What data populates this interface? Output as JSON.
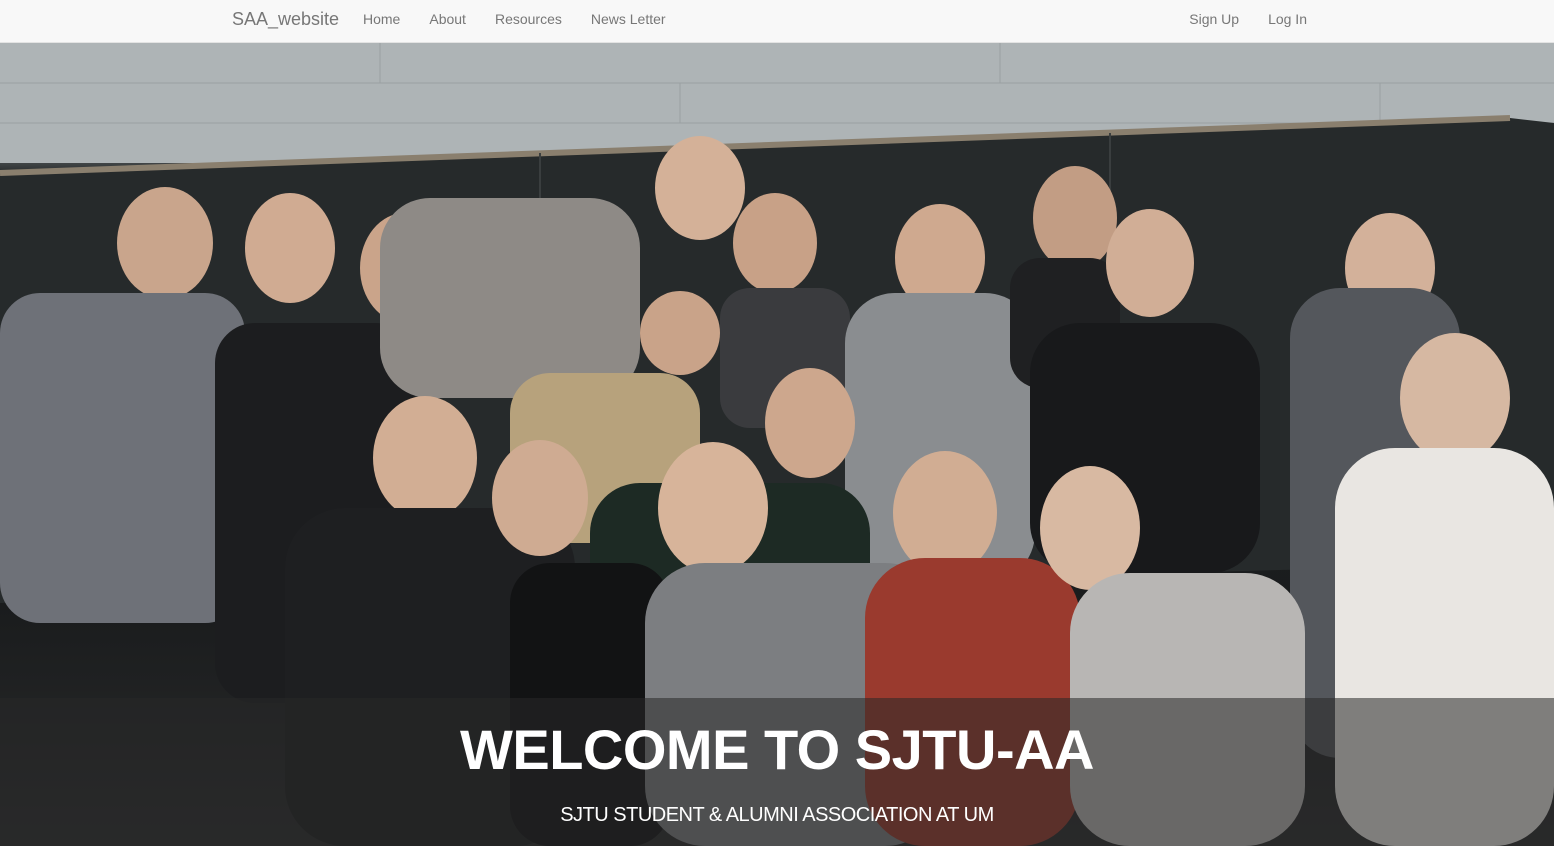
{
  "navbar": {
    "brand": "SAA_website",
    "links": [
      {
        "label": "Home"
      },
      {
        "label": "About"
      },
      {
        "label": "Resources"
      },
      {
        "label": "News Letter"
      }
    ],
    "auth": [
      {
        "label": "Sign Up"
      },
      {
        "label": "Log In"
      }
    ]
  },
  "hero": {
    "image_alt": "group-photo",
    "title": "WELCOME TO SJTU-AA",
    "subtitle": "SJTU STUDENT & ALUMNI ASSOCIATION AT UM"
  },
  "colors": {
    "navbar_bg": "#f8f8f8",
    "nav_text": "#777777",
    "banner_text": "#ffffff"
  }
}
